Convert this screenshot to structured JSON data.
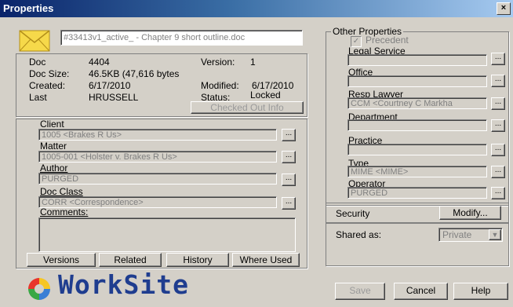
{
  "window": {
    "title": "Properties",
    "close_glyph": "×"
  },
  "document_name": "#33413v1_active_ - Chapter 9 short outline.doc",
  "info": {
    "doc_label": "Doc",
    "doc_value": "4404",
    "version_label": "Version:",
    "version_value": "1",
    "size_label": "Doc Size:",
    "size_value": "46.5KB (47,616 bytes",
    "created_label": "Created:",
    "created_value": "6/17/2010",
    "modified_label": "Modified:",
    "modified_value": "6/17/2010",
    "last_label": "Last",
    "last_value": "HRUSSELL",
    "status_label": "Status:",
    "status_value": "Locked",
    "checked_out_button": "Checked Out Info"
  },
  "profile": {
    "client_label": "Client",
    "client_value": "1005 <Brakes R Us>",
    "matter_label": "Matter",
    "matter_value": "1005-001 <Holster v. Brakes R Us>",
    "author_label": "Author",
    "author_value": "PURGED",
    "class_label": "Doc Class",
    "class_value": "CORR <Correspondence>",
    "comments_label": "Comments:",
    "comments_value": ""
  },
  "tabs": {
    "versions": "Versions",
    "related": "Related",
    "history": "History",
    "where_used": "Where Used"
  },
  "other": {
    "legend": "Other Properties",
    "precedent_label": "Precedent",
    "legal_label": "Legal Service",
    "legal_value": "",
    "office_label": "Office",
    "office_value": "",
    "resp_label": "Resp Lawyer",
    "resp_value": "CCM <Courtney C Markha",
    "dept_label": "Department",
    "dept_value": "",
    "practice_label": "Practice",
    "practice_value": "",
    "type_label": "Type",
    "type_value": "MIME <MIME>",
    "operator_label": "Operator",
    "operator_value": "PURGED"
  },
  "security": {
    "label": "Security",
    "modify_button": "Modify..."
  },
  "shared": {
    "label": "Shared as:",
    "value": "Private"
  },
  "buttons": {
    "save": "Save",
    "cancel": "Cancel",
    "help": "Help",
    "browse": "..."
  },
  "branding": {
    "logo_text": "WorkSite"
  }
}
